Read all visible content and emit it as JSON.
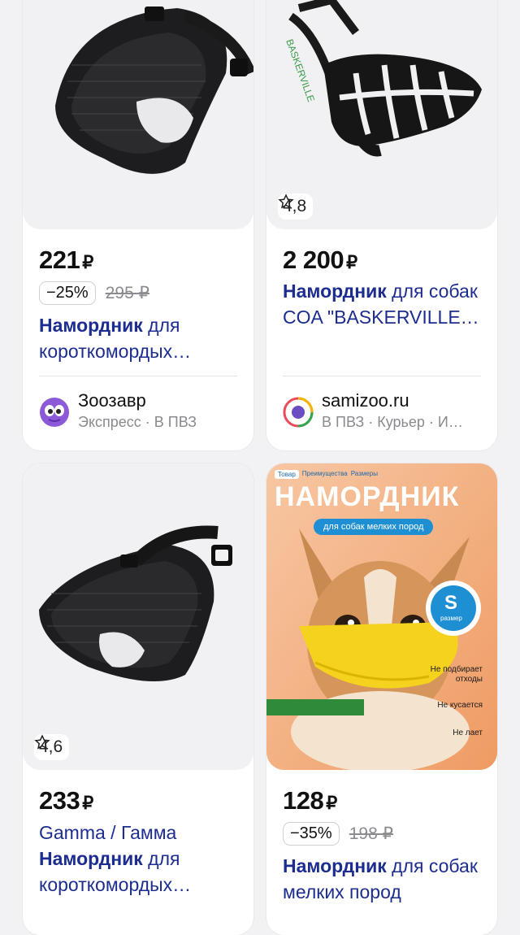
{
  "products": [
    {
      "price": "221",
      "currency": "₽",
      "discount": "−25%",
      "old_price": "295 ₽",
      "title_bold": "Намордник",
      "title_rest": " для короткомордых…",
      "seller_name": "Зоозавр",
      "seller_sub": "Экспресс · В ПВЗ"
    },
    {
      "rating": "4,8",
      "price": "2 200",
      "currency": "₽",
      "title_bold": "Намордник",
      "title_rest": " для собак COA \"BASKERVILLE…",
      "seller_name": "samizoo.ru",
      "seller_sub": "В ПВЗ · Курьер · И…"
    },
    {
      "rating": "4,6",
      "price": "233",
      "currency": "₽",
      "brand": "Gamma / Гамма",
      "title_bold": "Намордник",
      "title_rest": " для короткомордых…"
    },
    {
      "price": "128",
      "currency": "₽",
      "discount": "−35%",
      "old_price": "198 ₽",
      "title_bold": "Намордник",
      "title_rest": " для собак мелких пород",
      "image_text": {
        "tags": [
          "Товар",
          "Преимущества",
          "Размеры"
        ],
        "headline": "НАМОРДНИК",
        "subline": "для собак мелких пород",
        "size_letter": "S",
        "size_label": "размер",
        "feature_1": "Не подбирает отходы",
        "feature_2": "Не кусается",
        "feature_3": "Не лает"
      }
    }
  ]
}
